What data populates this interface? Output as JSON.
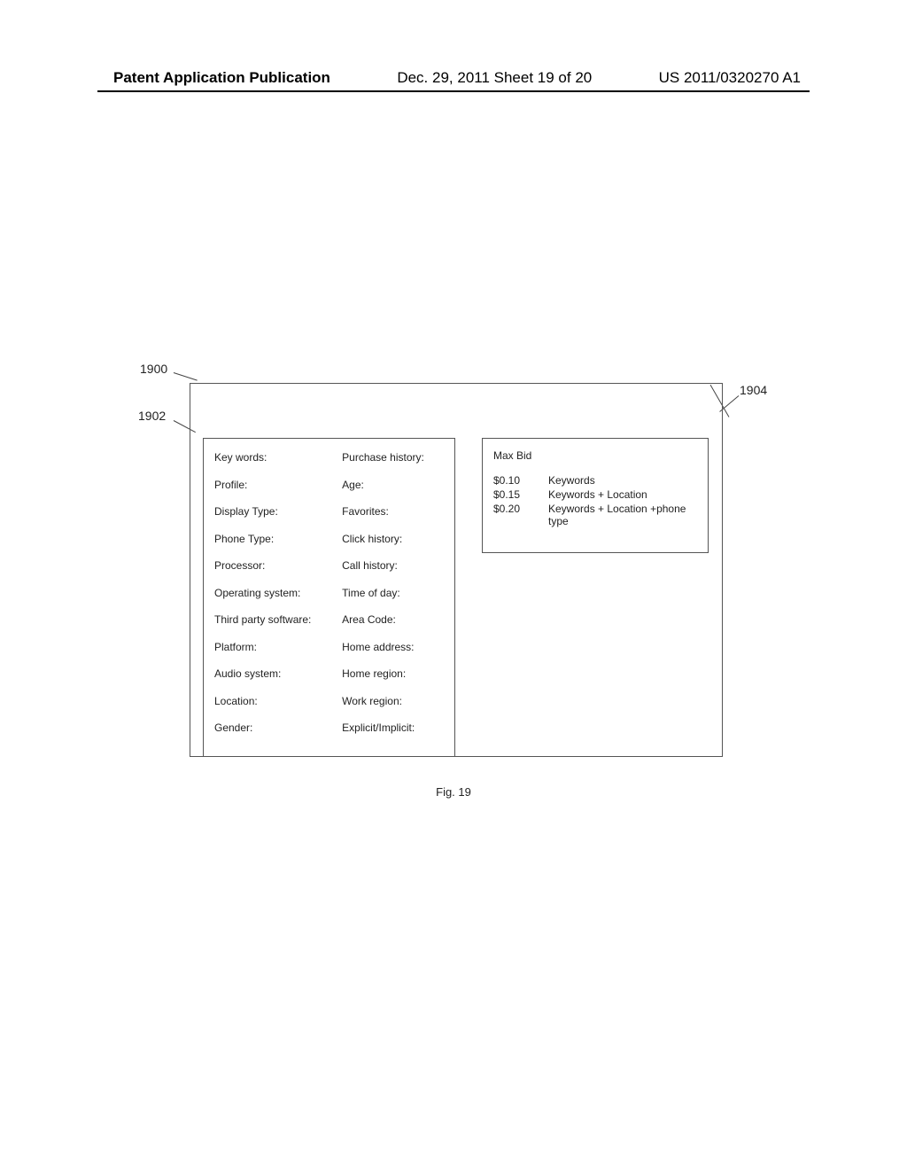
{
  "header": {
    "left": "Patent Application Publication",
    "center": "Dec. 29, 2011  Sheet 19 of 20",
    "right": "US 2011/0320270 A1"
  },
  "refs": {
    "r1900": "1900",
    "r1902": "1902",
    "r1904": "1904"
  },
  "leftPanel": {
    "col1": [
      "Key words:",
      "Profile:",
      "Display Type:",
      "Phone Type:",
      "Processor:",
      "Operating system:",
      "Third party software:",
      "Platform:",
      "Audio system:",
      "Location:",
      "Gender:"
    ],
    "col2": [
      "Purchase history:",
      "Age:",
      "Favorites:",
      "Click history:",
      "Call history:",
      "Time of day:",
      "Area Code:",
      "Home address:",
      "Home region:",
      "Work region:",
      "Explicit/Implicit:"
    ]
  },
  "rightPanel": {
    "heading": "Max Bid",
    "rows": [
      {
        "amount": "$0.10",
        "desc": "Keywords"
      },
      {
        "amount": "$0.15",
        "desc": "Keywords + Location"
      },
      {
        "amount": "$0.20",
        "desc": "Keywords + Location +phone type"
      }
    ]
  },
  "caption": "Fig. 19"
}
